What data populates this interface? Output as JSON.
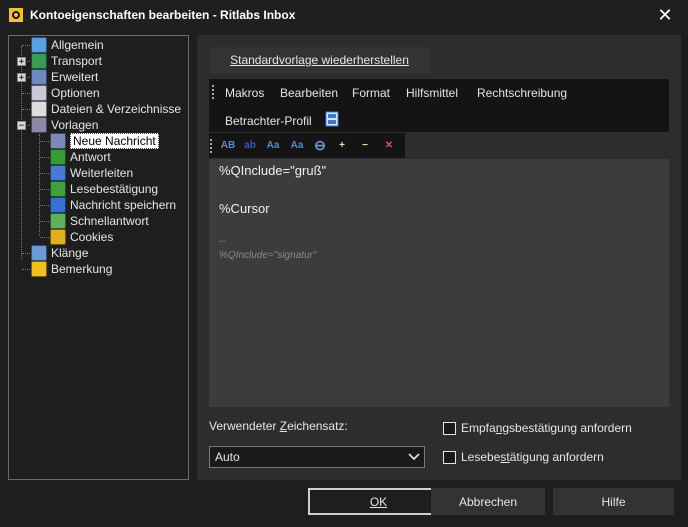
{
  "window": {
    "title": "Kontoeigenschaften bearbeiten - Ritlabs Inbox",
    "close_glyph": "✕"
  },
  "tree": {
    "items": [
      {
        "label": "Allgemein",
        "icon": "settings-icon",
        "color": "#5aa0e0",
        "expander": ""
      },
      {
        "label": "Transport",
        "icon": "transport-icon",
        "color": "#3a9a5a",
        "expander": "+"
      },
      {
        "label": "Erweitert",
        "icon": "advanced-icon",
        "color": "#6a8ac0",
        "expander": "+"
      },
      {
        "label": "Optionen",
        "icon": "options-icon",
        "color": "#c8c8d8",
        "expander": ""
      },
      {
        "label": "Dateien & Verzeichnisse",
        "icon": "files-icon",
        "color": "#dddddd",
        "expander": ""
      },
      {
        "label": "Vorlagen",
        "icon": "templates-icon",
        "color": "#8a8aa8",
        "expander": "−"
      },
      {
        "label": "Neue Nachricht",
        "icon": "new-message-icon",
        "color": "#7a8ab8",
        "expander": ""
      },
      {
        "label": "Antwort",
        "icon": "reply-icon",
        "color": "#3a9a3a",
        "expander": ""
      },
      {
        "label": "Weiterleiten",
        "icon": "forward-icon",
        "color": "#4a7ad0",
        "expander": ""
      },
      {
        "label": "Lesebestätigung",
        "icon": "read-receipt-icon",
        "color": "#40a040",
        "expander": ""
      },
      {
        "label": "Nachricht speichern",
        "icon": "save-message-icon",
        "color": "#3a70d0",
        "expander": ""
      },
      {
        "label": "Schnellantwort",
        "icon": "quick-reply-icon",
        "color": "#60b060",
        "expander": ""
      },
      {
        "label": "Cookies",
        "icon": "cookies-icon",
        "color": "#e0b020",
        "expander": ""
      },
      {
        "label": "Klänge",
        "icon": "sounds-icon",
        "color": "#6a9ad8",
        "expander": ""
      },
      {
        "label": "Bemerkung",
        "icon": "note-icon",
        "color": "#f0c020",
        "expander": ""
      }
    ],
    "selected": "Neue Nachricht"
  },
  "panel": {
    "restore_label": "Standardvorlage wiederherstellen",
    "menu": [
      "Makros",
      "Bearbeiten",
      "Format",
      "Hilfsmittel",
      "Rechtschreibung"
    ],
    "viewer_profile": "Betrachter-Profil",
    "viewer_profile_icon": "profile-icon",
    "toolbar": [
      {
        "icon": "spellcheck-icon",
        "glyph": "AB"
      },
      {
        "icon": "highlight-icon",
        "glyph": "ab"
      },
      {
        "icon": "font-size-icon",
        "glyph": "Aa"
      },
      {
        "icon": "font-icon",
        "glyph": "Aa"
      },
      {
        "icon": "insert-macro-icon",
        "glyph": "⊖"
      },
      {
        "icon": "zoom-in-icon",
        "glyph": "+"
      },
      {
        "icon": "zoom-out-icon",
        "glyph": "−"
      },
      {
        "icon": "clear-formatting-icon",
        "glyph": "✕"
      }
    ],
    "editor": {
      "line1": "%QInclude=\"gruß\"",
      "line2": "%Cursor",
      "sig_sep": "--",
      "sig_line": "%QInclude=\"signatur\""
    },
    "charset_label": "Verwendeter Zeichensatz:",
    "charset_value": "Auto",
    "check_receipt": "Empfangsbestätigung anfordern",
    "check_read": "Lesebestätigung anfordern"
  },
  "buttons": {
    "ok": "OK",
    "cancel": "Abbrechen",
    "help": "Hilfe"
  }
}
